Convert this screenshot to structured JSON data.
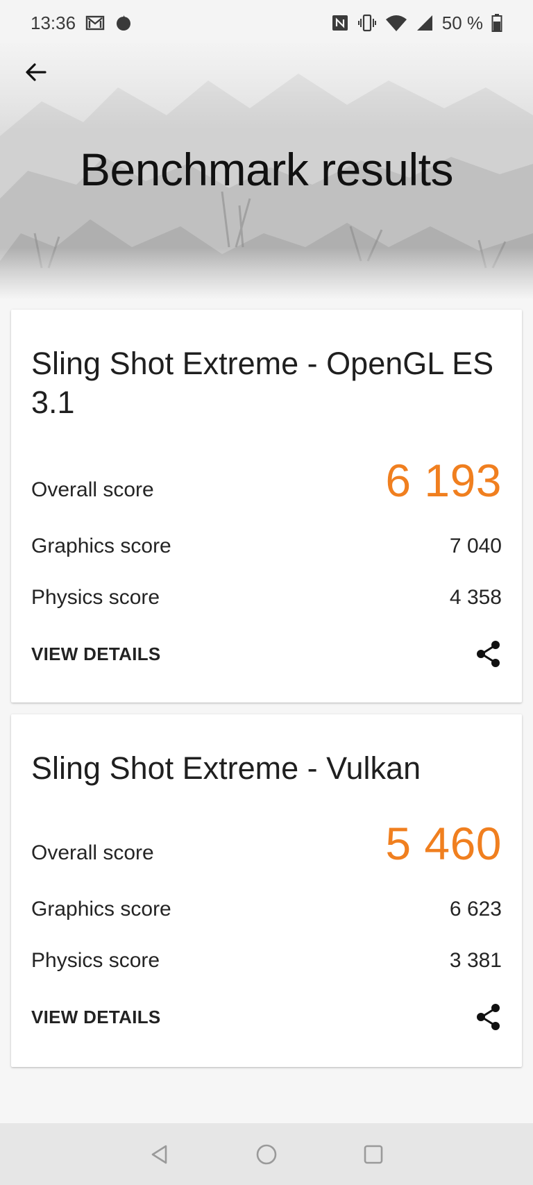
{
  "status_bar": {
    "time": "13:36",
    "battery": "50 %",
    "icons": [
      "gmail-icon",
      "notification-dot-icon",
      "nfc-icon",
      "vibrate-icon",
      "wifi-icon",
      "signal-icon",
      "battery-icon"
    ]
  },
  "header": {
    "title": "Benchmark results",
    "back_icon": "arrow-left-icon"
  },
  "accent_color": "#f07f1f",
  "results": [
    {
      "title": "Sling Shot Extreme - OpenGL ES 3.1",
      "overall_label": "Overall score",
      "overall_value": "6 193",
      "graphics_label": "Graphics score",
      "graphics_value": "7 040",
      "physics_label": "Physics score",
      "physics_value": "4 358",
      "details_label": "VIEW DETAILS"
    },
    {
      "title": "Sling Shot Extreme - Vulkan",
      "overall_label": "Overall score",
      "overall_value": "5 460",
      "graphics_label": "Graphics score",
      "graphics_value": "6 623",
      "physics_label": "Physics score",
      "physics_value": "3 381",
      "details_label": "VIEW DETAILS"
    }
  ],
  "nav_bar": {
    "icons": [
      "nav-back-icon",
      "nav-home-icon",
      "nav-recents-icon"
    ]
  }
}
